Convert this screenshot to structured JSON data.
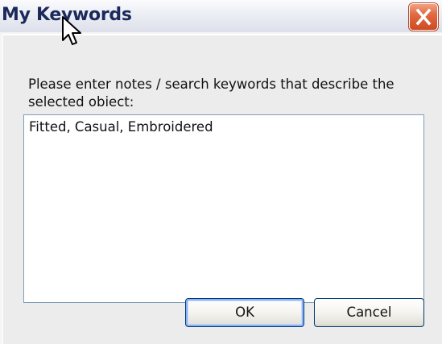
{
  "window": {
    "title": "My Keywords",
    "close_icon": "close-icon"
  },
  "dialog": {
    "prompt": "Please enter notes / search keywords that describe the selected obiect:",
    "keywords_value": "Fitted, Casual, Embroidered"
  },
  "buttons": {
    "ok_label": "OK",
    "cancel_label": "Cancel"
  },
  "colors": {
    "title_text": "#1b2a5a",
    "close_button": "#e06a43",
    "dialog_background": "#ececec",
    "field_border": "#7f9db9",
    "button_border": "#003c74"
  },
  "cursor_icon": "mouse-pointer-icon"
}
